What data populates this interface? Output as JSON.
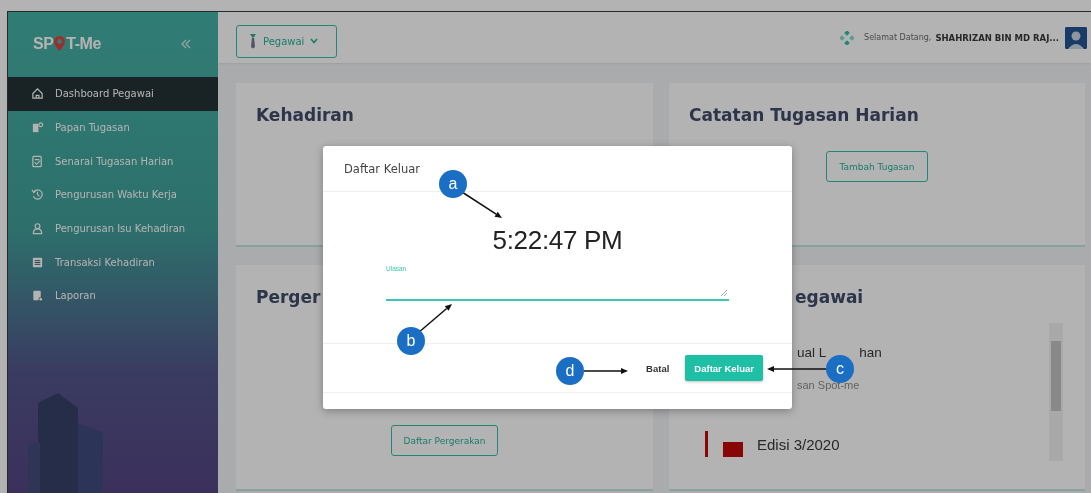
{
  "sidebar": {
    "logo": {
      "before": "SP",
      "after": "T-Me"
    },
    "items": [
      {
        "label": "Dashboard Pegawai",
        "selected": true
      },
      {
        "label": "Papan Tugasan",
        "selected": false
      },
      {
        "label": "Senarai Tugasan Harian",
        "selected": false
      },
      {
        "label": "Pengurusan Waktu Kerja",
        "selected": false
      },
      {
        "label": "Pengurusan Isu Kehadiran",
        "selected": false
      },
      {
        "label": "Transaksi Kehadiran",
        "selected": false
      },
      {
        "label": "Laporan",
        "selected": false
      }
    ]
  },
  "topbar": {
    "role_button": "Pegawai",
    "greeting": "Selamat Datang,",
    "user_name": "SHAHRIZAN BIN MD RAJ..."
  },
  "cards": [
    {
      "title": "Kehadiran"
    },
    {
      "title": "Catatan Tugasan Harian",
      "button": "Tambah Tugasan"
    },
    {
      "title": "Perger",
      "button": "Daftar Pergerakan"
    },
    {
      "title": "egawai",
      "items": [
        {
          "kind": "text",
          "title": "ual L",
          "title_end": "han",
          "subtitle": "san Spot-me"
        },
        {
          "kind": "thumbnail",
          "title": "Edisi 3/2020"
        }
      ]
    }
  ],
  "modal": {
    "title": "Daftar Keluar",
    "time": "5:22:47 PM",
    "field_label": "Ulasan",
    "cancel_button": "Batal",
    "confirm_button": "Daftar Keluar"
  },
  "annotations": [
    {
      "label": "a"
    },
    {
      "label": "b"
    },
    {
      "label": "c"
    },
    {
      "label": "d"
    }
  ]
}
